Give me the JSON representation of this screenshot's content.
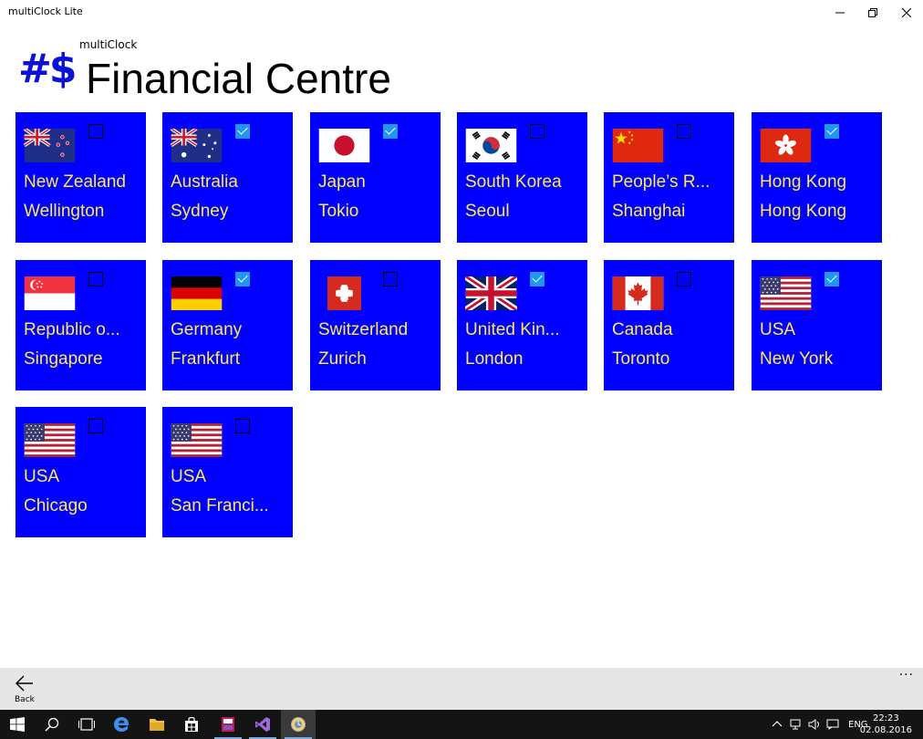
{
  "window": {
    "title": "multiClock Lite"
  },
  "header": {
    "logo": "#$",
    "app_name": "multiClock",
    "page_title": "Financial Centre"
  },
  "tiles": [
    {
      "country": "New Zealand",
      "city": "Wellington",
      "checked": false,
      "flag": "new-zealand-flag"
    },
    {
      "country": "Australia",
      "city": "Sydney",
      "checked": true,
      "flag": "australia-flag"
    },
    {
      "country": "Japan",
      "city": "Tokio",
      "checked": true,
      "flag": "japan-flag"
    },
    {
      "country": "South Korea",
      "city": "Seoul",
      "checked": false,
      "flag": "south-korea-flag"
    },
    {
      "country": "People’s R...",
      "city": "Shanghai",
      "checked": false,
      "flag": "china-flag"
    },
    {
      "country": "Hong Kong",
      "city": "Hong Kong",
      "checked": true,
      "flag": "hong-kong-flag"
    },
    {
      "country": "Republic o...",
      "city": "Singapore",
      "checked": false,
      "flag": "singapore-flag"
    },
    {
      "country": "Germany",
      "city": "Frankfurt",
      "checked": true,
      "flag": "germany-flag"
    },
    {
      "country": "Switzerland",
      "city": "Zurich",
      "checked": false,
      "flag": "switzerland-flag"
    },
    {
      "country": "United Kin...",
      "city": "London",
      "checked": true,
      "flag": "uk-flag"
    },
    {
      "country": "Canada",
      "city": "Toronto",
      "checked": false,
      "flag": "canada-flag"
    },
    {
      "country": "USA",
      "city": "New York",
      "checked": true,
      "flag": "usa-flag"
    },
    {
      "country": "USA",
      "city": "Chicago",
      "checked": false,
      "flag": "usa-flag"
    },
    {
      "country": "USA",
      "city": "San Franci...",
      "checked": false,
      "flag": "usa-flag"
    }
  ],
  "appbar": {
    "back_label": "Back",
    "more_label": "···"
  },
  "taskbar": {
    "language": "ENG",
    "time": "22:23",
    "date": "02.08.2016",
    "apps": [
      "start-icon",
      "search-icon",
      "task-view-icon",
      "edge-icon",
      "file-explorer-icon",
      "store-icon",
      "media-app-icon",
      "visual-studio-icon",
      "multiclock-app-icon"
    ]
  },
  "colors": {
    "tile_bg": "#0000ff",
    "tile_text": "#ffe94a",
    "logo": "#0a12d8",
    "check_on": "#2196f3"
  }
}
